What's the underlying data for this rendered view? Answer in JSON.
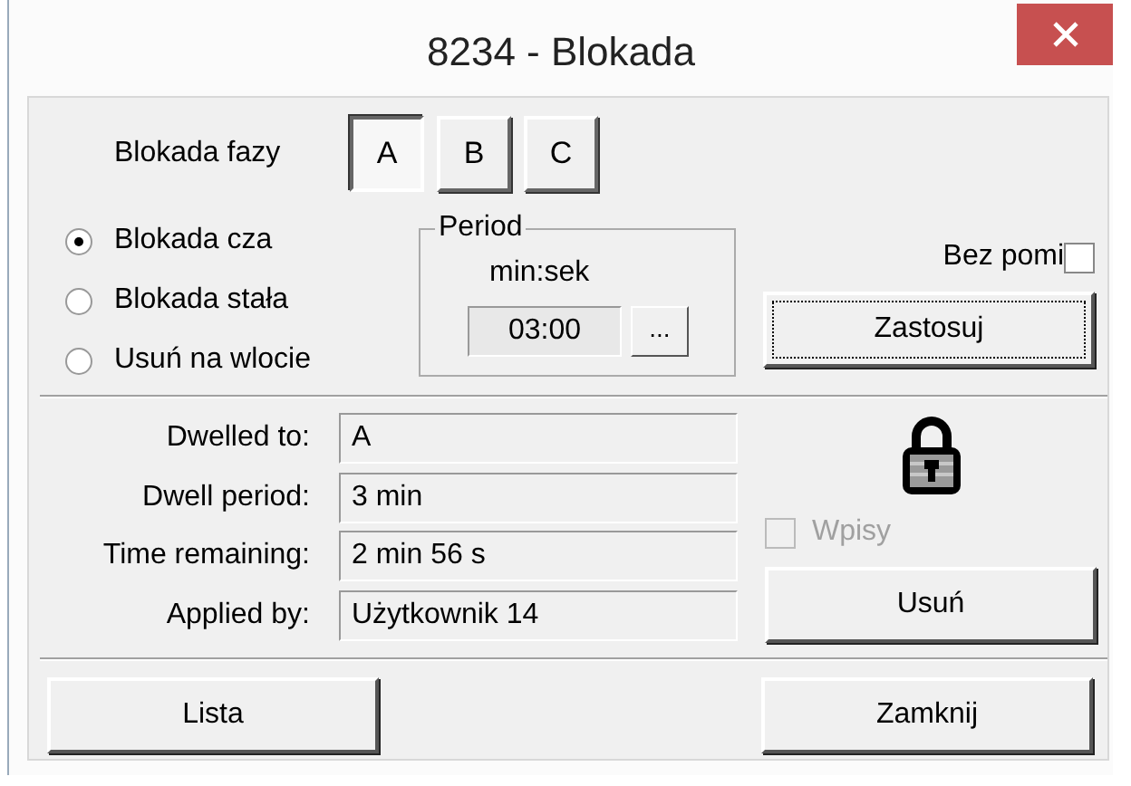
{
  "window": {
    "title": "8234 - Blokada"
  },
  "phase": {
    "label": "Blokada fazy",
    "buttons": [
      {
        "label": "A",
        "selected": true
      },
      {
        "label": "B",
        "selected": false
      },
      {
        "label": "C",
        "selected": false
      }
    ]
  },
  "modes": [
    {
      "label": "Blokada cza",
      "selected": true
    },
    {
      "label": "Blokada stała",
      "selected": false
    },
    {
      "label": "Usuń na wlocie",
      "selected": false
    }
  ],
  "period": {
    "title": "Period",
    "unit": "min:sek",
    "value": "03:00",
    "browse_button": "..."
  },
  "bez_pomi": {
    "label": "Bez pomi",
    "checked": false
  },
  "apply_button": "Zastosuj",
  "info": [
    {
      "label": "Dwelled to:",
      "value": "A"
    },
    {
      "label": "Dwell period:",
      "value": "3 min"
    },
    {
      "label": "Time remaining:",
      "value": "2 min 56 s"
    },
    {
      "label": "Applied by:",
      "value": "Użytkownik 14"
    }
  ],
  "wpisy": {
    "label": "Wpisy",
    "checked": false,
    "disabled": true
  },
  "remove_button": "Usuń",
  "buttons": [
    "Lista",
    "Zamknij"
  ]
}
